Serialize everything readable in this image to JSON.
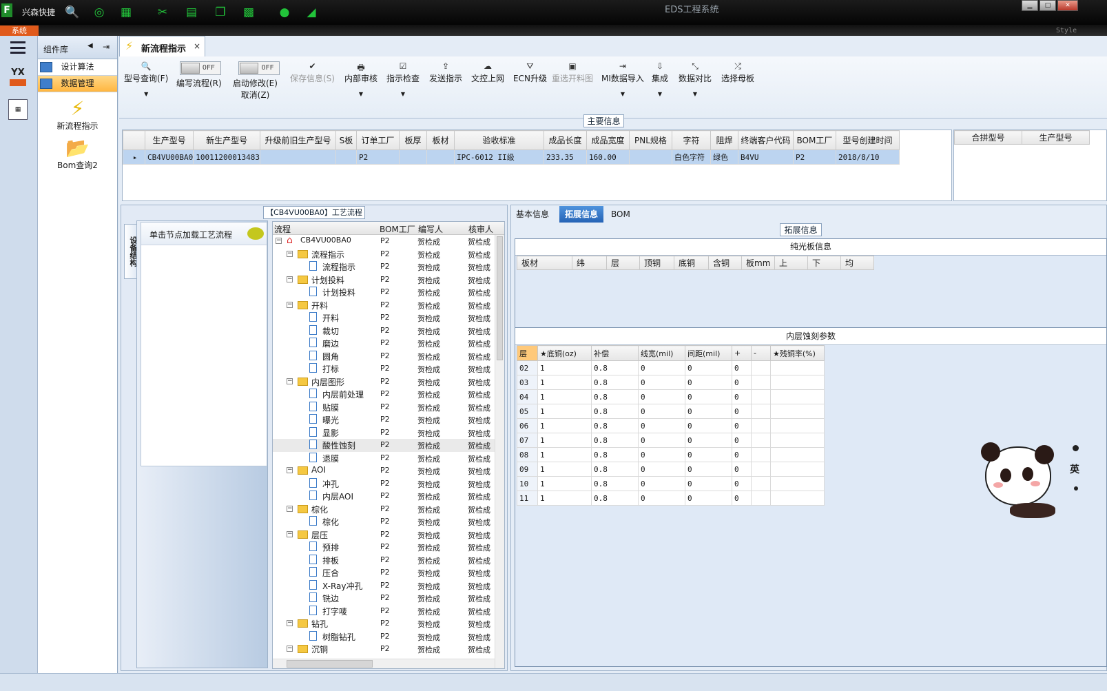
{
  "app": {
    "name": "兴森快捷",
    "title": "EDS工程系统",
    "system_tab": "系统",
    "style_label": "Style",
    "colors": {
      "accent": "#e05a1b",
      "selected": "#ffb640",
      "toolbar_green": "#22c33a"
    }
  },
  "quick_icons": [
    "search-icon",
    "lifebuoy-icon",
    "table-icon",
    "scissors-icon",
    "film-icon",
    "copy-icon",
    "grid-icon",
    "user-icon",
    "chart-icon"
  ],
  "sidebar": {
    "header": "组件库",
    "items": [
      {
        "label": "设计算法",
        "selected": false
      },
      {
        "label": "数据管理",
        "selected": true
      }
    ],
    "big_items": [
      {
        "label": "新流程指示",
        "icon": "lightning-icon"
      },
      {
        "label": "Bom查询2",
        "icon": "folder-icon"
      }
    ]
  },
  "tab": {
    "label": "新流程指示",
    "close": "×"
  },
  "toolbar": {
    "items": [
      {
        "label": "型号查询(F)",
        "icon": "search-icon",
        "caret": true,
        "disabled": false
      },
      {
        "label": "编写流程(R)",
        "toggle": "OFF"
      },
      {
        "label": "启动修改(E)",
        "sub": "取消(Z)",
        "toggle": "OFF"
      },
      {
        "label": "保存信息(S)",
        "icon": "check-icon",
        "disabled": true
      },
      {
        "label": "内部审核",
        "icon": "print-icon",
        "caret": true
      },
      {
        "label": "指示检查",
        "icon": "checkbox-icon",
        "caret": true
      },
      {
        "label": "发送指示",
        "icon": "upload-icon"
      },
      {
        "label": "文控上网",
        "icon": "cloud-upload-icon"
      },
      {
        "label": "ECN升级",
        "icon": "road-icon"
      },
      {
        "label": "重选开料图",
        "icon": "image-icon",
        "disabled": true
      },
      {
        "label": "MI数据导入",
        "icon": "login-icon",
        "caret": true
      },
      {
        "label": "集成",
        "icon": "download-icon",
        "caret": true
      },
      {
        "label": "数据对比",
        "icon": "compress-icon",
        "caret": true
      },
      {
        "label": "选择母板",
        "icon": "shuffle-icon"
      }
    ]
  },
  "main_info": {
    "title": "主要信息",
    "columns": [
      "生产型号",
      "新生产型号",
      "升级前旧生产型号",
      "S板",
      "订单工厂",
      "板厚",
      "板材",
      "验收标准",
      "成品长度",
      "成品宽度",
      "PNL规格",
      "字符",
      "阻焊",
      "终端客户代码",
      "BOM工厂",
      "型号创建时间"
    ],
    "row": [
      "CB4VU00BA0",
      "10011200013483",
      "",
      "",
      "P2",
      "",
      "",
      "IPC-6012 II级",
      "233.35",
      "160.00",
      "",
      "白色字符",
      "绿色",
      "B4VU",
      "P2",
      "2018/8/10"
    ],
    "side_columns": [
      "合拼型号",
      "生产型号"
    ]
  },
  "process": {
    "title": "【CB4VU00BA0】工艺流程",
    "vertical_tab": "设备结构",
    "hint": "单击节点加载工艺流程",
    "columns": [
      "流程",
      "BOM工厂",
      "编写人",
      "核审人"
    ],
    "root": "CB4VU00BA0",
    "nodes": [
      {
        "name": "流程指示",
        "level": 1
      },
      {
        "name": "流程指示",
        "level": 2
      },
      {
        "name": "计划投料",
        "level": 1
      },
      {
        "name": "计划投料",
        "level": 2
      },
      {
        "name": "开料",
        "level": 1
      },
      {
        "name": "开料",
        "level": 2
      },
      {
        "name": "裁切",
        "level": 2
      },
      {
        "name": "磨边",
        "level": 2
      },
      {
        "name": "圆角",
        "level": 2
      },
      {
        "name": "打标",
        "level": 2
      },
      {
        "name": "内层图形",
        "level": 1
      },
      {
        "name": "内层前处理",
        "level": 2
      },
      {
        "name": "贴膜",
        "level": 2
      },
      {
        "name": "曝光",
        "level": 2
      },
      {
        "name": "显影",
        "level": 2
      },
      {
        "name": "酸性蚀刻",
        "level": 2
      },
      {
        "name": "退膜",
        "level": 2
      },
      {
        "name": "AOI",
        "level": 1
      },
      {
        "name": "冲孔",
        "level": 2
      },
      {
        "name": "内层AOI",
        "level": 2
      },
      {
        "name": "棕化",
        "level": 1
      },
      {
        "name": "棕化",
        "level": 2
      },
      {
        "name": "层压",
        "level": 1
      },
      {
        "name": "预排",
        "level": 2
      },
      {
        "name": "排板",
        "level": 2
      },
      {
        "name": "压合",
        "level": 2
      },
      {
        "name": "X-Ray冲孔",
        "level": 2
      },
      {
        "name": "铣边",
        "level": 2
      },
      {
        "name": "打字唛",
        "level": 2
      },
      {
        "name": "钻孔",
        "level": 1
      },
      {
        "name": "树脂钻孔",
        "level": 2
      },
      {
        "name": "沉铜",
        "level": 1
      }
    ],
    "bom": "P2",
    "writer": "贺检成",
    "reviewer": "贺检成"
  },
  "detail": {
    "tabs": [
      "基本信息",
      "拓展信息",
      "BOM"
    ],
    "active_tab": "拓展信息",
    "panel_title": "拓展信息",
    "bare": {
      "title": "纯光板信息",
      "columns": [
        "板材",
        "纬",
        "层",
        "顶铜",
        "底铜",
        "含铜",
        "板mm",
        "上",
        "下",
        "均"
      ]
    },
    "etch": {
      "title": "内层蚀刻参数",
      "columns": [
        "层",
        "★底铜(oz)",
        "补偿",
        "线宽(mil)",
        "间距(mil)",
        "+",
        "-",
        "★残铜率(%)"
      ],
      "rows": [
        [
          "02",
          "1",
          "0.8",
          "0",
          "0",
          "0",
          "",
          ""
        ],
        [
          "03",
          "1",
          "0.8",
          "0",
          "0",
          "0",
          "",
          ""
        ],
        [
          "04",
          "1",
          "0.8",
          "0",
          "0",
          "0",
          "",
          ""
        ],
        [
          "05",
          "1",
          "0.8",
          "0",
          "0",
          "0",
          "",
          ""
        ],
        [
          "06",
          "1",
          "0.8",
          "0",
          "0",
          "0",
          "",
          ""
        ],
        [
          "07",
          "1",
          "0.8",
          "0",
          "0",
          "0",
          "",
          ""
        ],
        [
          "08",
          "1",
          "0.8",
          "0",
          "0",
          "0",
          "",
          ""
        ],
        [
          "09",
          "1",
          "0.8",
          "0",
          "0",
          "0",
          "",
          ""
        ],
        [
          "10",
          "1",
          "0.8",
          "0",
          "0",
          "0",
          "",
          ""
        ],
        [
          "11",
          "1",
          "0.8",
          "0",
          "0",
          "0",
          "",
          ""
        ]
      ]
    }
  },
  "mascot": {
    "icon": "panda-mascot-icon",
    "text": "英"
  }
}
